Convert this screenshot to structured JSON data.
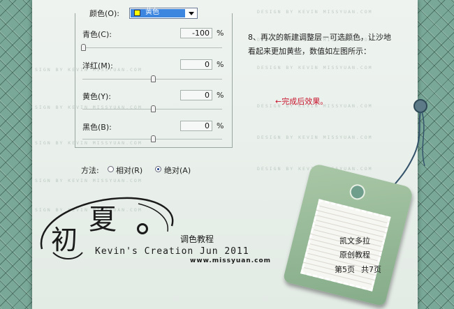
{
  "watermark": "DESIGN BY KEVIN MISSYUAN.COM",
  "watermark_small": "SIGN BY KEVIN MISSYUAN.COM",
  "panel": {
    "color_label": "颜色(O):",
    "color_value": "黄色",
    "rows": [
      {
        "label": "青色(C):",
        "value": "-100",
        "pct": "%",
        "slider": 0.0
      },
      {
        "label": "洋红(M):",
        "value": "0",
        "pct": "%",
        "slider": 0.5
      },
      {
        "label": "黄色(Y):",
        "value": "0",
        "pct": "%",
        "slider": 0.5
      },
      {
        "label": "黑色(B):",
        "value": "0",
        "pct": "%",
        "slider": 0.5
      }
    ],
    "method_label": "方法:",
    "relative_label": "相对(R)",
    "absolute_label": "绝对(A)",
    "selected_method": "absolute"
  },
  "instructions": {
    "line1": "8、再次的新建调整层－可选颜色，让沙地",
    "line2": "看起来更加黄些，数值如左图所示：",
    "result_note": "←完成后效果。"
  },
  "logo": {
    "char1": "初",
    "char2": "夏",
    "subtitle": "调色教程",
    "creation": "Kevin's Creation Jun 2011",
    "url": "www.missyuan.com"
  },
  "tag": {
    "line1": "凯文多拉",
    "line2": "原创教程",
    "page": "第5页",
    "total": "共7页"
  },
  "colors": {
    "accent_red": "#c8142c",
    "select_blue": "#3d86e0",
    "swatch_yellow": "#ffff00"
  }
}
